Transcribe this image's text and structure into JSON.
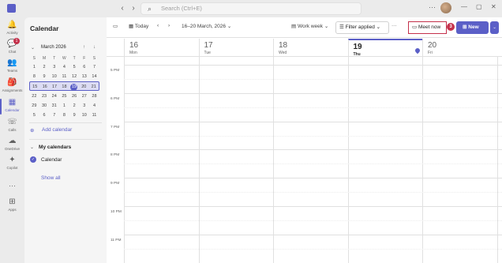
{
  "topbar": {
    "search_placeholder": "Search (Ctrl+E)",
    "more": "···",
    "back": "‹",
    "forward": "›",
    "win_min": "—",
    "win_max": "▢",
    "win_close": "✕"
  },
  "rail": {
    "items": [
      {
        "label": "Activity",
        "icon": "bell-icon",
        "glyph": "🔔"
      },
      {
        "label": "Chat",
        "icon": "chat-icon",
        "glyph": "💬",
        "badge": "1"
      },
      {
        "label": "Teams",
        "icon": "teams-icon",
        "glyph": "👥"
      },
      {
        "label": "Assignments",
        "icon": "assignments-icon",
        "glyph": "🎒"
      },
      {
        "label": "Calendar",
        "icon": "calendar-icon",
        "glyph": "▦"
      },
      {
        "label": "Calls",
        "icon": "phone-icon",
        "glyph": "☏"
      },
      {
        "label": "OneDrive",
        "icon": "cloud-icon",
        "glyph": "☁"
      },
      {
        "label": "Copilot",
        "icon": "copilot-icon",
        "glyph": "✦"
      }
    ],
    "more": "···",
    "apps": {
      "label": "Apps",
      "icon": "apps-icon",
      "glyph": "⊞"
    }
  },
  "leftpane": {
    "title": "Calendar",
    "month": "March 2026",
    "dow": [
      "S",
      "M",
      "T",
      "W",
      "T",
      "F",
      "S"
    ],
    "weeks": [
      [
        "1",
        "2",
        "3",
        "4",
        "5",
        "6",
        "7"
      ],
      [
        "8",
        "9",
        "10",
        "11",
        "12",
        "13",
        "14"
      ],
      [
        "15",
        "16",
        "17",
        "18",
        "19",
        "20",
        "21"
      ],
      [
        "22",
        "23",
        "24",
        "25",
        "26",
        "27",
        "28"
      ],
      [
        "29",
        "30",
        "31",
        "1",
        "2",
        "3",
        "4"
      ],
      [
        "5",
        "6",
        "7",
        "8",
        "9",
        "10",
        "11"
      ]
    ],
    "add_calendar": "Add calendar",
    "my_calendars": "My calendars",
    "calendar_item": "Calendar",
    "show_all": "Show all"
  },
  "toolbar": {
    "today": "Today",
    "range": "16–20 March, 2026",
    "view": "Work week",
    "filter": "Filter applied",
    "more": "···",
    "meet_now": "Meet now",
    "annotation": "3",
    "new": "New"
  },
  "days": [
    {
      "num": "16",
      "name": "Mon"
    },
    {
      "num": "17",
      "name": "Tue"
    },
    {
      "num": "18",
      "name": "Wed"
    },
    {
      "num": "19",
      "name": "Thu"
    },
    {
      "num": "20",
      "name": "Fri"
    }
  ],
  "times": [
    "5 PM",
    "6 PM",
    "7 PM",
    "8 PM",
    "9 PM",
    "10 PM",
    "11 PM"
  ],
  "colors": {
    "accent": "#5b5fc7",
    "alert": "#c4314b"
  }
}
